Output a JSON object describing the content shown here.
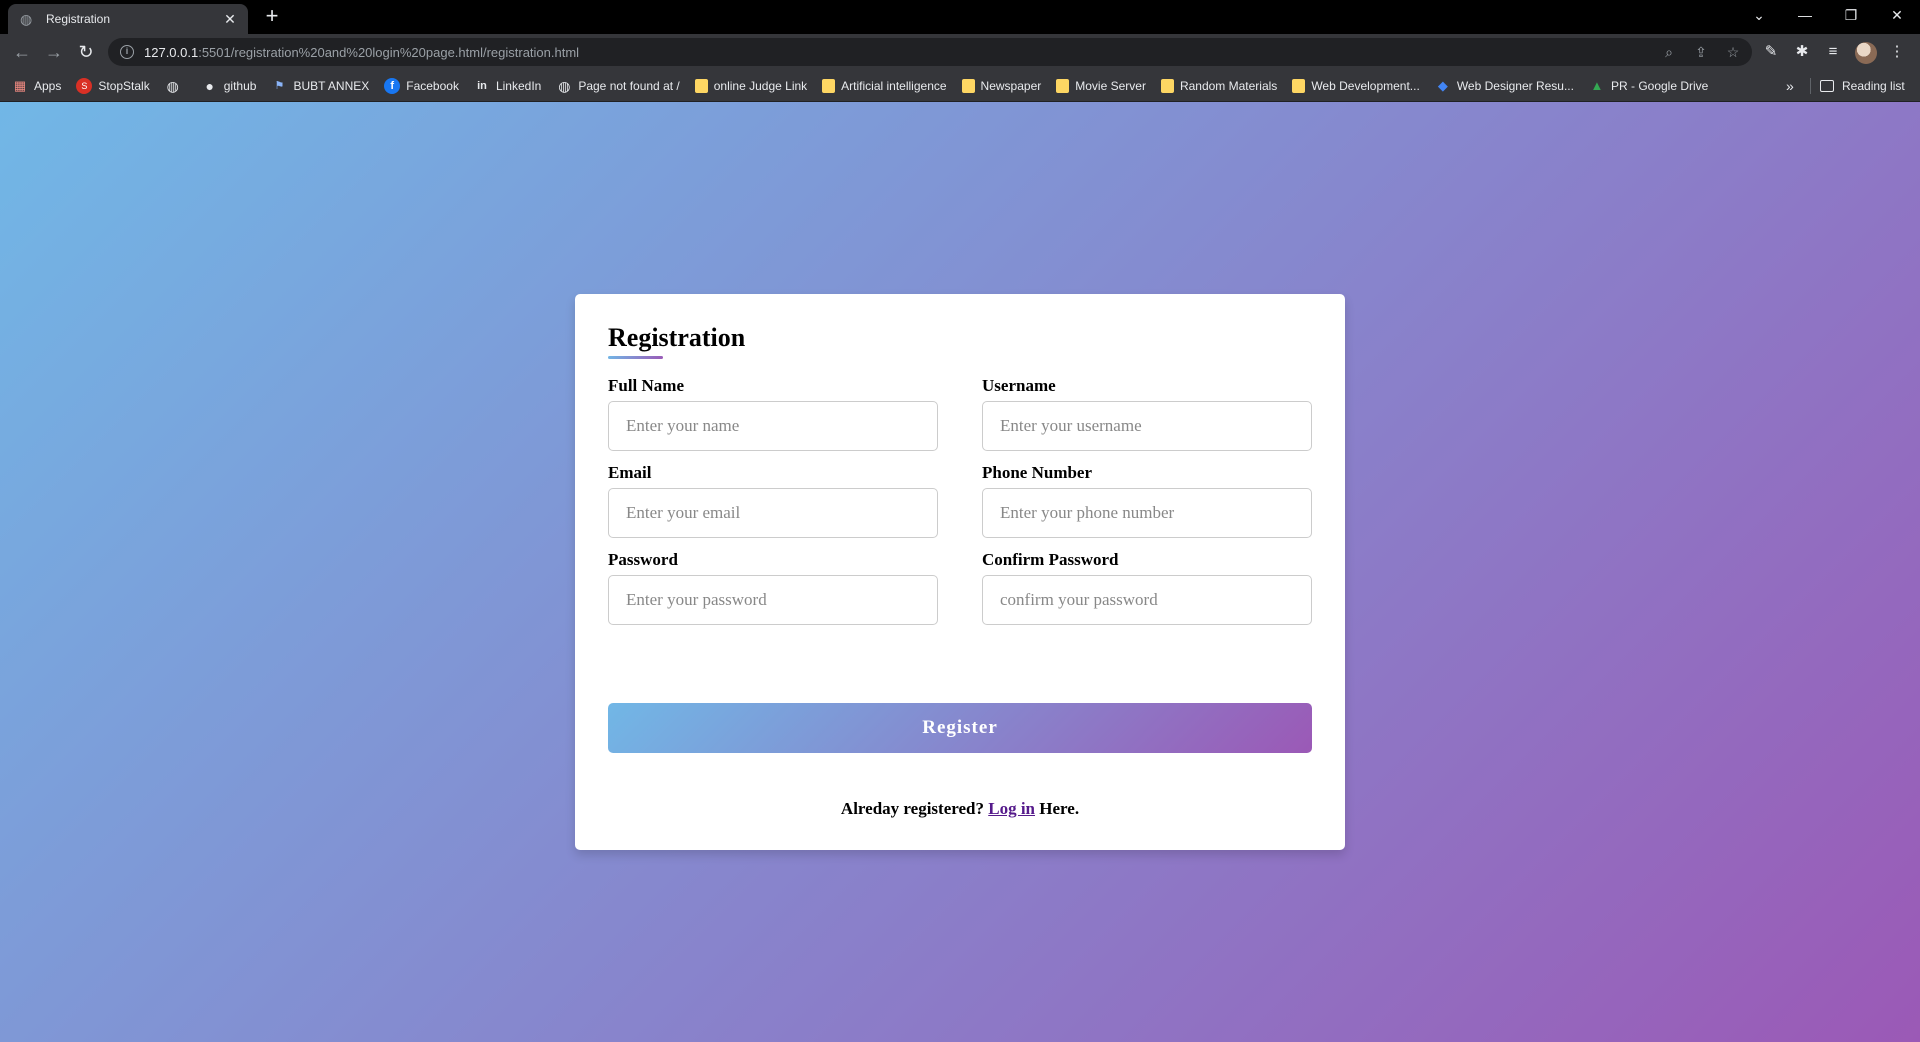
{
  "browser": {
    "tab_title": "Registration",
    "tab_close": "✕",
    "new_tab": "+",
    "url_host": "127.0.0.1",
    "url_path": ":5501/registration%20and%20login%20page.html/registration.html",
    "bookmarks": [
      {
        "label": "Apps",
        "icon": "apps-icon"
      },
      {
        "label": "StopStalk",
        "icon": "stopstalk-icon"
      },
      {
        "label": "",
        "icon": "globe-icon"
      },
      {
        "label": "github",
        "icon": "github-icon"
      },
      {
        "label": "BUBT ANNEX",
        "icon": "bubt-icon"
      },
      {
        "label": "Facebook",
        "icon": "facebook-icon"
      },
      {
        "label": "LinkedIn",
        "icon": "linkedin-icon"
      },
      {
        "label": "Page not found at /",
        "icon": "globe-icon"
      },
      {
        "label": "online Judge Link",
        "icon": "folder-icon"
      },
      {
        "label": "Artificial intelligence",
        "icon": "folder-icon"
      },
      {
        "label": "Newspaper",
        "icon": "folder-icon"
      },
      {
        "label": "Movie Server",
        "icon": "folder-icon"
      },
      {
        "label": "Random Materials",
        "icon": "folder-icon"
      },
      {
        "label": "Web Development...",
        "icon": "folder-icon"
      },
      {
        "label": "Web Designer Resu...",
        "icon": "web-designer-icon"
      },
      {
        "label": "PR - Google Drive",
        "icon": "google-drive-icon"
      }
    ],
    "bookmarks_more": "»",
    "reading_list": "Reading list"
  },
  "form": {
    "title": "Registration",
    "fields": {
      "full_name": {
        "label": "Full Name",
        "placeholder": "Enter your name"
      },
      "username": {
        "label": "Username",
        "placeholder": "Enter your username"
      },
      "email": {
        "label": "Email",
        "placeholder": "Enter your email"
      },
      "phone": {
        "label": "Phone Number",
        "placeholder": "Enter your phone number"
      },
      "password": {
        "label": "Password",
        "placeholder": "Enter your password"
      },
      "confirm_password": {
        "label": "Confirm Password",
        "placeholder": "confirm your password"
      }
    },
    "register_label": "Register",
    "login_prefix": "Alreday registered?",
    "login_link": "Log in",
    "login_suffix": "Here."
  },
  "colors": {
    "gradient_start": "#71b7e6",
    "gradient_end": "#9b59b6",
    "link": "#551a8b"
  }
}
